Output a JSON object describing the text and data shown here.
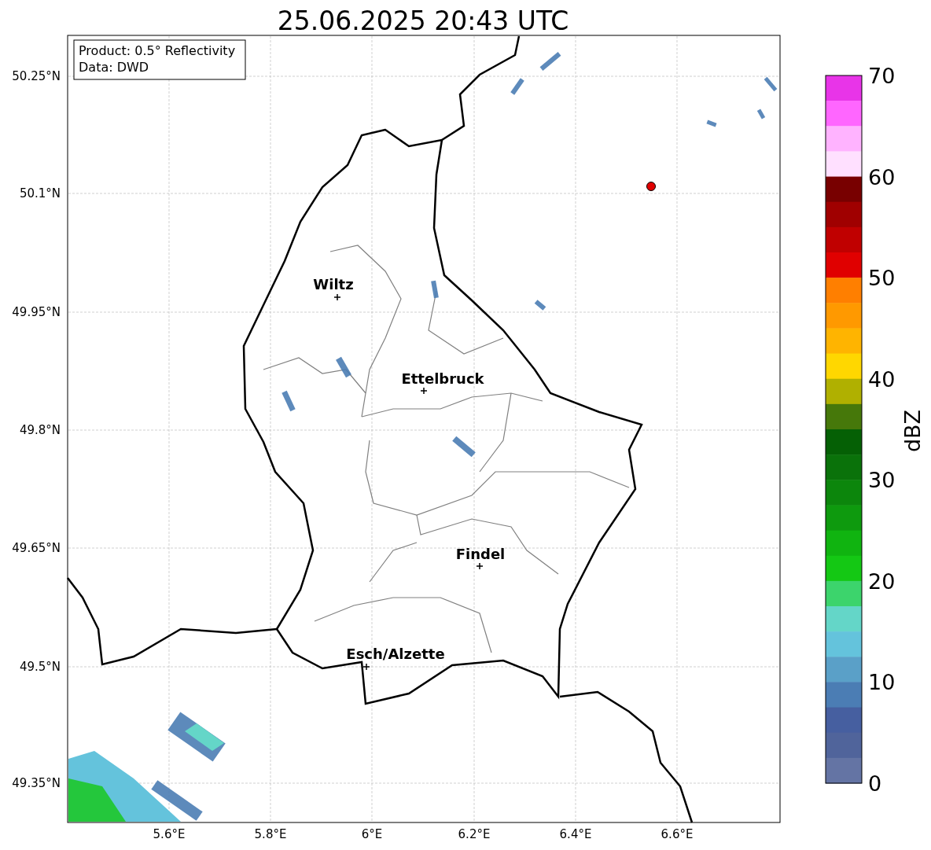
{
  "title": "25.06.2025 20:43 UTC",
  "info_box": [
    "Product: 0.5° Reflectivity",
    "Data: DWD"
  ],
  "y_ticks": [
    "50.25°N",
    "50.1°N",
    "49.95°N",
    "49.8°N",
    "49.65°N",
    "49.5°N",
    "49.35°N"
  ],
  "x_ticks": [
    "5.6°E",
    "5.8°E",
    "6°E",
    "6.2°E",
    "6.4°E",
    "6.6°E"
  ],
  "cities": [
    {
      "name": "Wiltz"
    },
    {
      "name": "Ettelbruck"
    },
    {
      "name": "Findel"
    },
    {
      "name": "Esch/Alzette"
    }
  ],
  "colorbar": {
    "label": "dBZ",
    "ticks": [
      "70",
      "60",
      "50",
      "40",
      "30",
      "20",
      "10",
      "0"
    ],
    "segments": [
      {
        "color": "#e834e8"
      },
      {
        "color": "#ff66ff"
      },
      {
        "color": "#ffb3ff"
      },
      {
        "color": "#ffe0ff"
      },
      {
        "color": "#780000"
      },
      {
        "color": "#a00000"
      },
      {
        "color": "#c00000"
      },
      {
        "color": "#e00000"
      },
      {
        "color": "#ff7f00"
      },
      {
        "color": "#ff9900"
      },
      {
        "color": "#ffb400"
      },
      {
        "color": "#ffd700"
      },
      {
        "color": "#b0b000"
      },
      {
        "color": "#46780a"
      },
      {
        "color": "#056005"
      },
      {
        "color": "#0a720a"
      },
      {
        "color": "#0c860c"
      },
      {
        "color": "#0e9a0e"
      },
      {
        "color": "#10b410"
      },
      {
        "color": "#14c814"
      },
      {
        "color": "#3cd46c"
      },
      {
        "color": "#64d6c8"
      },
      {
        "color": "#64c3dc"
      },
      {
        "color": "#5aa0c8"
      },
      {
        "color": "#4b7db4"
      },
      {
        "color": "#465fa0"
      },
      {
        "color": "#50649b"
      },
      {
        "color": "#6474a4"
      }
    ]
  }
}
